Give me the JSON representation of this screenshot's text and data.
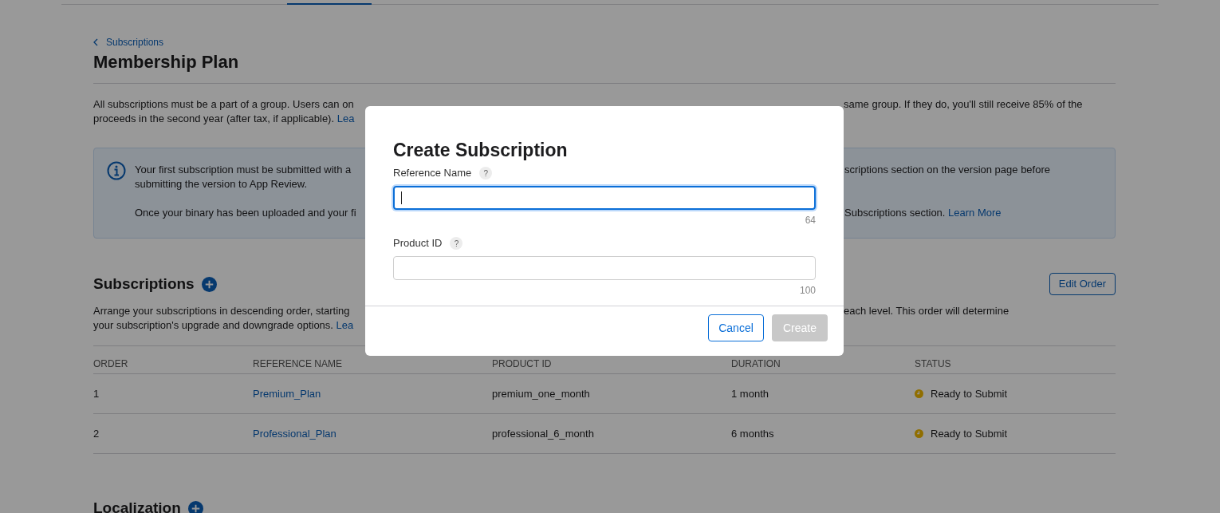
{
  "breadcrumb": {
    "label": "Subscriptions"
  },
  "title": "Membership Plan",
  "intro": {
    "lines": [
      {
        "left": "All subscriptions must be a part of a group. Users can on",
        "right": "same group. If they do, you'll still receive 85% of the"
      },
      {
        "left": "proceeds in the second year (after tax, if applicable).",
        "left_link": "Lea"
      }
    ]
  },
  "notice": {
    "lines": [
      {
        "left": "Your first subscription must be submitted with a",
        "right": "scriptions section on the version page before"
      },
      {
        "left": "submitting the version to App Review."
      },
      {
        "left": "Once your binary has been uploaded and your fi",
        "right": "Subscriptions section.",
        "right_link": "Learn More"
      }
    ]
  },
  "subscriptions": {
    "title": "Subscriptions",
    "edit_button": "Edit Order",
    "description": {
      "lines": [
        {
          "left": "Arrange your subscriptions in descending order, starting",
          "right": "each level. This order will determine"
        },
        {
          "left": "your subscription's upgrade and downgrade options.",
          "left_link": "Lea"
        }
      ]
    },
    "table": {
      "columns": [
        "ORDER",
        "REFERENCE NAME",
        "PRODUCT ID",
        "DURATION",
        "STATUS"
      ],
      "rows": [
        {
          "order": "1",
          "reference_name": "Premium_Plan",
          "product_id": "premium_one_month",
          "duration": "1 month",
          "status": "Ready to Submit"
        },
        {
          "order": "2",
          "reference_name": "Professional_Plan",
          "product_id": "professional_6_month",
          "duration": "6 months",
          "status": "Ready to Submit"
        }
      ]
    }
  },
  "localization": {
    "title": "Localization"
  },
  "dialog": {
    "title": "Create Subscription",
    "fields": [
      {
        "label": "Reference Name",
        "help": "?",
        "counter": "64",
        "focused": true
      },
      {
        "label": "Product ID",
        "help": "?",
        "counter": "100",
        "focused": false
      }
    ],
    "buttons": [
      {
        "kind": "secondary",
        "label": "Cancel",
        "disabled": false
      },
      {
        "kind": "primary",
        "label": "Create",
        "disabled": true
      }
    ]
  }
}
